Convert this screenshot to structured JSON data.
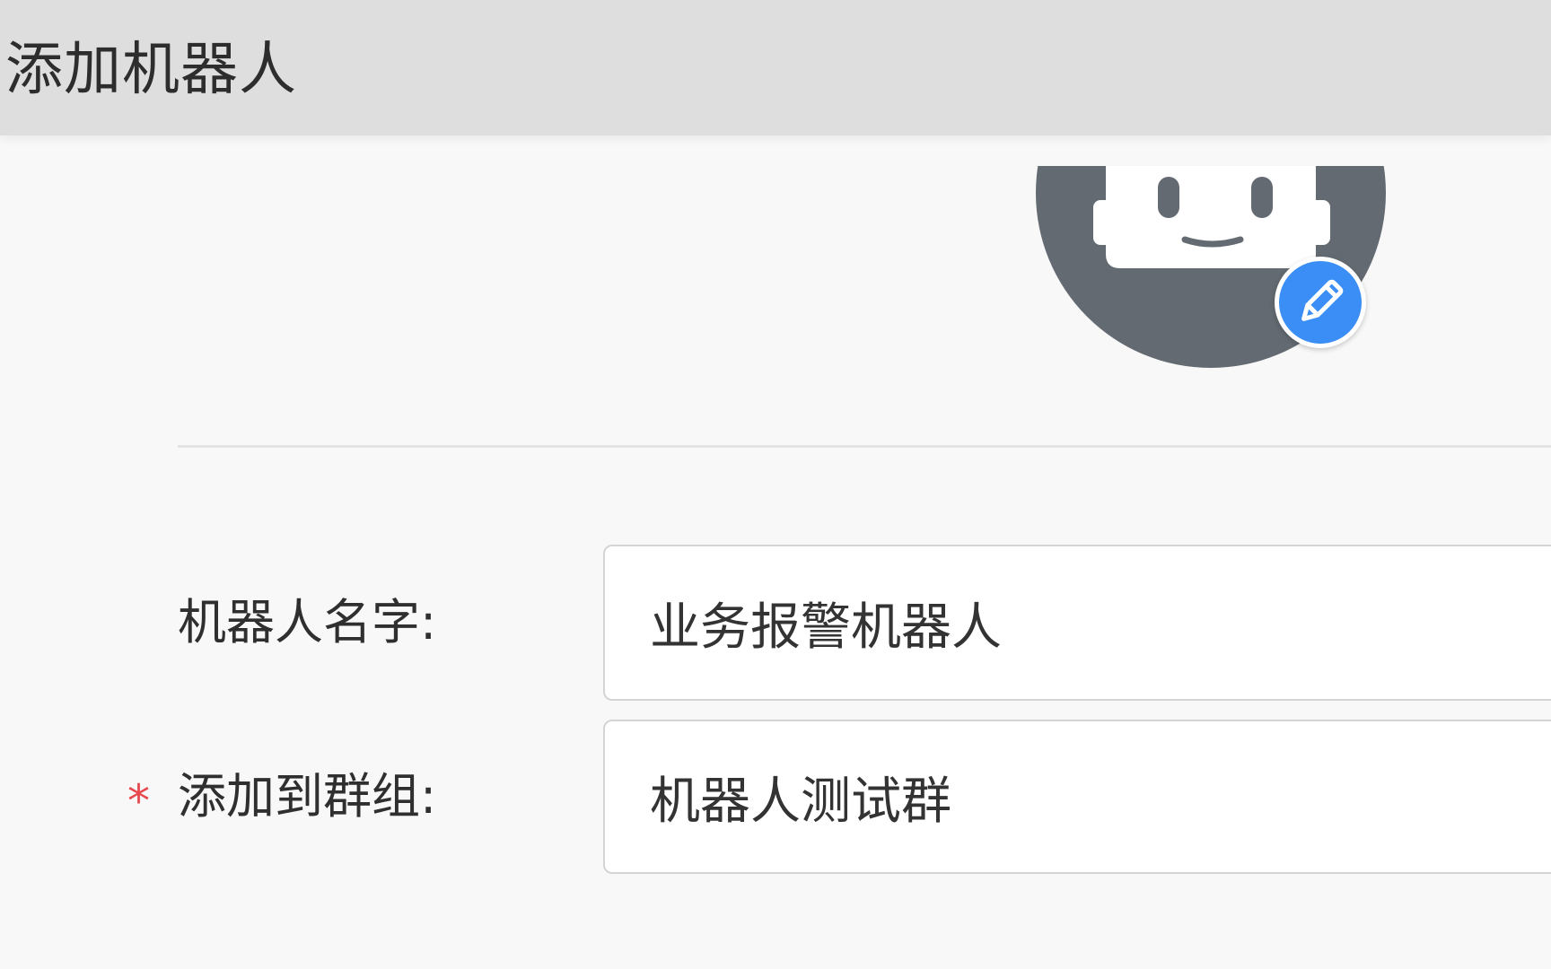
{
  "header": {
    "title": "添加机器人"
  },
  "avatar": {
    "icon": "robot-icon",
    "edit_icon": "pencil-icon",
    "colors": {
      "avatar_bg": "#636a71",
      "edit_badge": "#3a8ef6"
    }
  },
  "form": {
    "name": {
      "label": "机器人名字:",
      "value": "业务报警机器人"
    },
    "group": {
      "required_mark": "*",
      "label": "添加到群组:",
      "value": "机器人测试群"
    }
  }
}
